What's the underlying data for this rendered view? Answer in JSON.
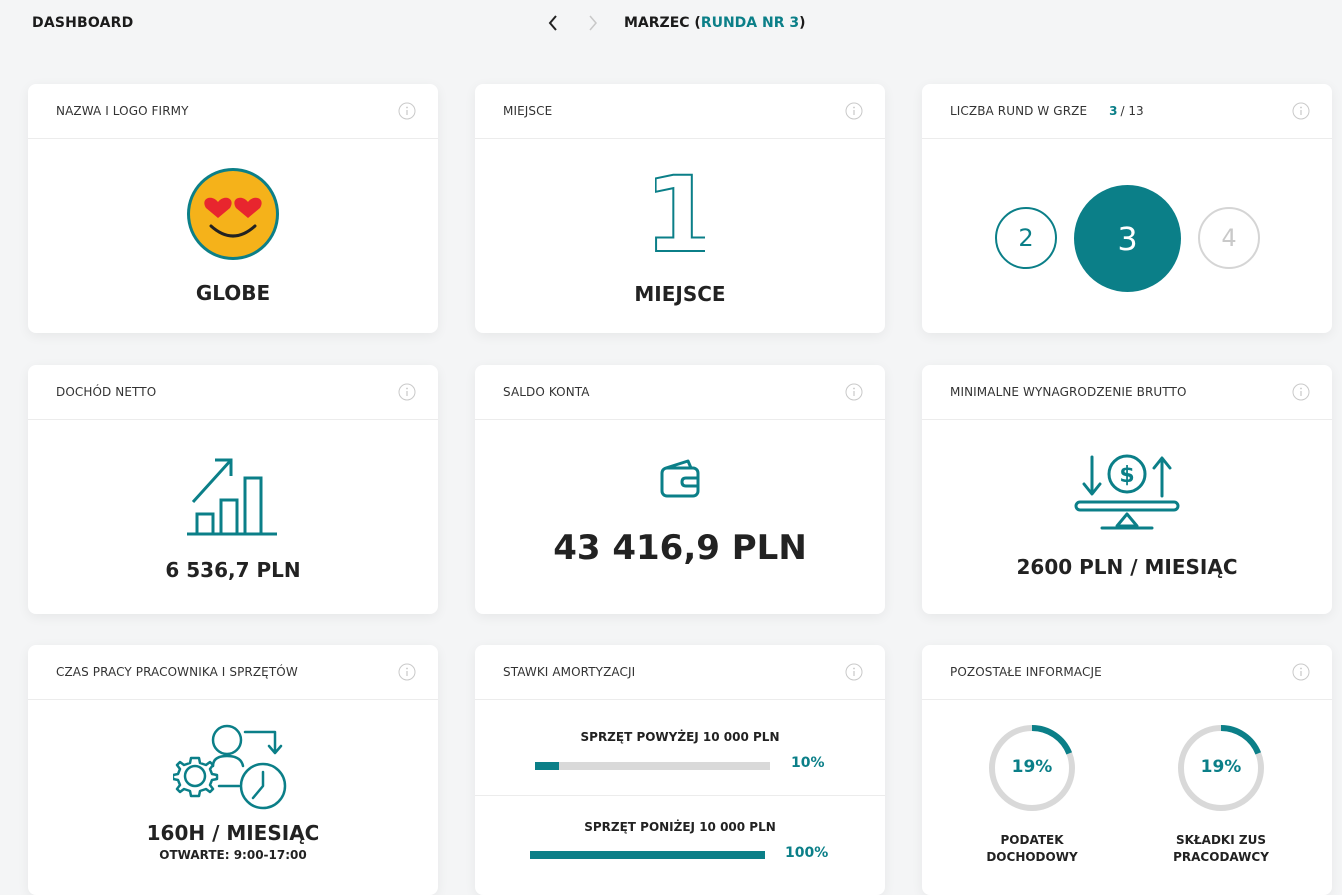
{
  "header": {
    "title": "DASHBOARD",
    "month": "MARZEC (",
    "round": "RUNDA NR 3",
    "close_paren": ")",
    "prev_icon": "chevron-left-icon",
    "next_icon": "chevron-right-icon"
  },
  "colors": {
    "accent": "#0b7f88",
    "track": "#d9d9d9"
  },
  "cards": {
    "company": {
      "title": "NAZWA I LOGO FIRMY",
      "name": "GLOBE",
      "icon": "heart-eyes-emoji-icon"
    },
    "place": {
      "title": "MIEJSCE",
      "number": "1",
      "label": "MIEJSCE"
    },
    "rounds": {
      "title": "LICZBA RUND W GRZE",
      "current": "3",
      "total": "/ 13",
      "prev": "2",
      "active": "3",
      "next": "4"
    },
    "income": {
      "title": "DOCHÓD NETTO",
      "value": "6 536,7 PLN",
      "icon": "growth-chart-icon"
    },
    "balance": {
      "title": "SALDO KONTA",
      "value": "43 416,9 PLN",
      "icon": "wallet-icon"
    },
    "salary": {
      "title": "MINIMALNE WYNAGRODZENIE BRUTTO",
      "value": "2600 PLN / MIESIĄC",
      "icon": "money-balance-icon"
    },
    "worktime": {
      "title": "CZAS PRACY PRACOWNIKA I SPRZĘTÓW",
      "value": "160H / MIESIĄC",
      "hours": "OTWARTE: 9:00-17:00",
      "icon": "worker-gear-clock-icon"
    },
    "depreciation": {
      "title": "STAWKI AMORTYZACJI",
      "items": [
        {
          "label": "SPRZĘT POWYŻEJ 10 000 PLN",
          "percent_text": "10%",
          "fraction": 0.1
        },
        {
          "label": "SPRZĘT PONIŻEJ 10 000 PLN",
          "percent_text": "100%",
          "fraction": 1.0
        }
      ]
    },
    "other": {
      "title": "POZOSTAŁE INFORMACJE",
      "rings": [
        {
          "value": "19%",
          "fraction": 0.19,
          "label_line1": "PODATEK",
          "label_line2": "DOCHODOWY"
        },
        {
          "value": "19%",
          "fraction": 0.19,
          "label_line1": "SKŁADKI ZUS",
          "label_line2": "PRACODAWCY"
        }
      ]
    }
  }
}
